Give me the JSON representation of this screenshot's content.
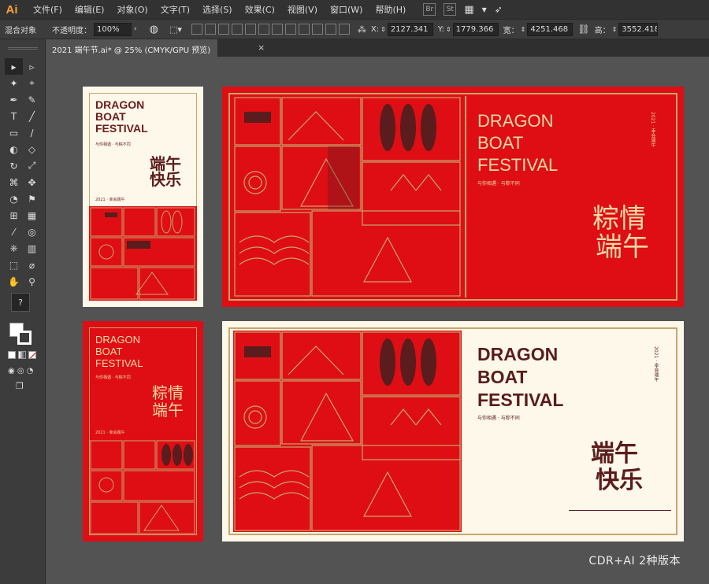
{
  "app": {
    "logo": "Ai"
  },
  "menu": [
    "文件(F)",
    "编辑(E)",
    "对象(O)",
    "文字(T)",
    "选择(S)",
    "效果(C)",
    "视图(V)",
    "窗口(W)",
    "帮助(H)"
  ],
  "menu_badges": [
    "Br",
    "St"
  ],
  "control": {
    "blend_label": "混合对象",
    "opacity_label": "不透明度：",
    "opacity_value": "100%",
    "x_label": "X:",
    "x_value": "2127.341",
    "y_label": "Y:",
    "y_value": "1779.366",
    "w_label": "宽：",
    "w_value": "4251.468",
    "h_label": "高：",
    "h_value": "3552.418"
  },
  "tab": {
    "title": "2021 端午节.ai* @ 25% (CMYK/GPU 预览)",
    "close": "×"
  },
  "tools": [
    "▸",
    "▹",
    "✦",
    "⌖",
    "✒",
    "✎",
    "T",
    "╱",
    "▭",
    "∕",
    "◐",
    "◇",
    "↻",
    "⤢",
    "⌘",
    "✥",
    "◔",
    "⚑",
    "⊞",
    "▦",
    "⁄",
    "◎",
    "⎈",
    "▥",
    "⬚",
    "⌀",
    "✋",
    "⚲"
  ],
  "colors": {
    "red": "#de0e14",
    "cream": "#fdf8ea",
    "gold": "#c8a66a",
    "dark": "#5a1c1c",
    "maroon": "#6b1d1d"
  },
  "art": {
    "en1": "DRAGON",
    "en2": "BOAT",
    "en3": "FESTIVAL",
    "cn_duan": "端午",
    "cn_kuai": "快乐",
    "cn_zong": "粽情",
    "cn_duanwu": "端午",
    "year": "2021 · 幸会端午",
    "slogan": "与你相遇 · 与粽不同"
  },
  "watermark": "CDR+AI 2种版本"
}
